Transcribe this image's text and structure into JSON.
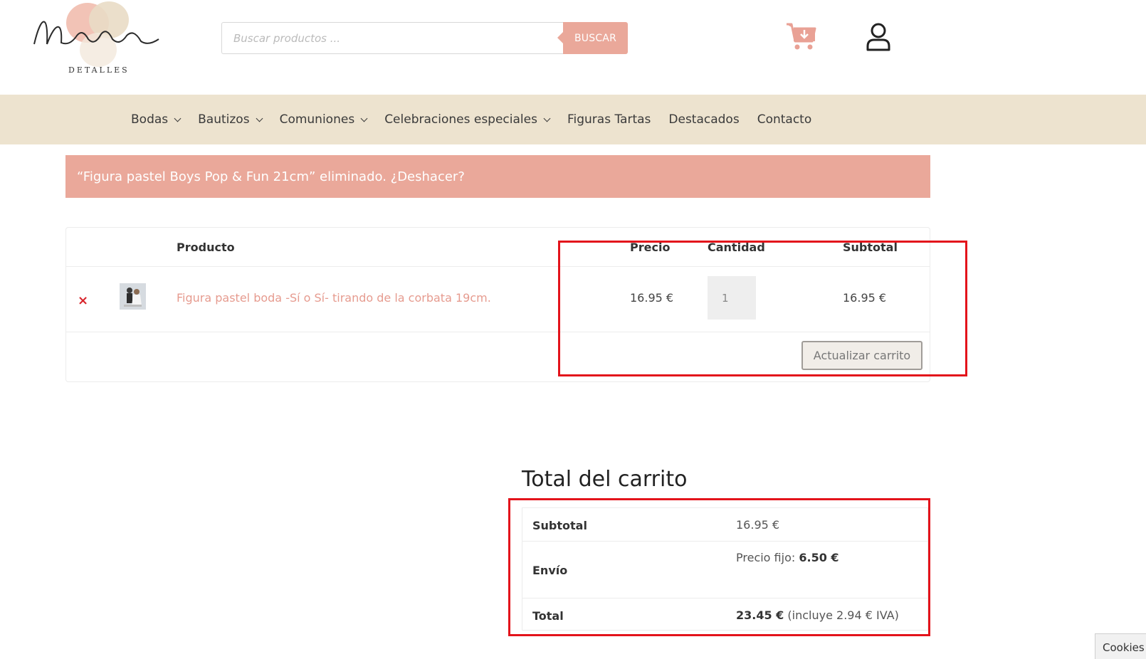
{
  "header": {
    "logo": {
      "name": "Nuriba",
      "tagline": "DETALLES"
    },
    "search": {
      "placeholder": "Buscar productos ...",
      "value": "",
      "button_label": "BUSCAR"
    },
    "icons": {
      "cart": "cart-download-icon",
      "user": "user-icon"
    }
  },
  "nav": {
    "items": [
      {
        "label": "Bodas",
        "has_dropdown": true
      },
      {
        "label": "Bautizos",
        "has_dropdown": true
      },
      {
        "label": "Comuniones",
        "has_dropdown": true
      },
      {
        "label": "Celebraciones especiales",
        "has_dropdown": true
      },
      {
        "label": "Figuras Tartas",
        "has_dropdown": false
      },
      {
        "label": "Destacados",
        "has_dropdown": false
      },
      {
        "label": "Contacto",
        "has_dropdown": false
      }
    ]
  },
  "notice": {
    "text": "“Figura pastel Boys Pop & Fun 21cm” eliminado. ¿Deshacer?"
  },
  "cart": {
    "headers": {
      "product": "Producto",
      "price": "Precio",
      "quantity": "Cantidad",
      "subtotal": "Subtotal"
    },
    "items": [
      {
        "remove_symbol": "×",
        "name": "Figura pastel boda -Sí o Sí- tirando de la corbata 19cm.",
        "price": "16.95 €",
        "quantity": "1",
        "subtotal": "16.95 €"
      }
    ],
    "update_button": "Actualizar carrito"
  },
  "totals": {
    "title": "Total del carrito",
    "subtotal_label": "Subtotal",
    "subtotal_value": "16.95 €",
    "shipping_label": "Envío",
    "shipping_prefix": "Precio fijo:",
    "shipping_value": "6.50 €",
    "total_label": "Total",
    "total_value": "23.45 €",
    "total_note": "(incluye 2.94 € IVA)"
  },
  "cookies": {
    "label": "Cookies"
  },
  "colors": {
    "accent": "#eaa89a",
    "nav_bg": "#ede3cf",
    "highlight": "#e3131b",
    "remove": "#d8232a"
  }
}
